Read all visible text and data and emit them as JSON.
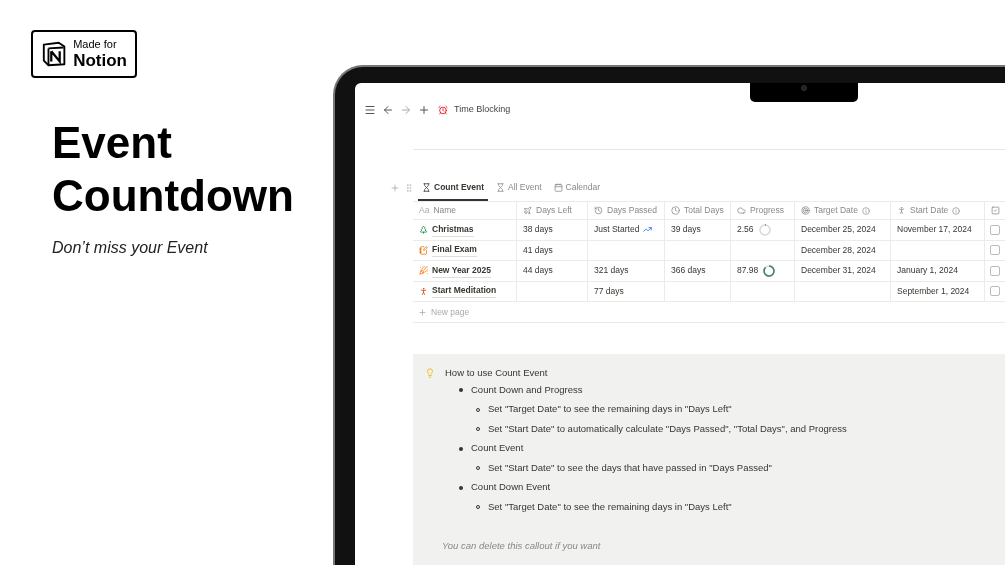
{
  "badge": {
    "line1": "Made for",
    "line2": "Notion"
  },
  "headline": [
    "Event",
    "Countdown"
  ],
  "tagline": "Don’t miss your Event",
  "app": {
    "breadcrumb": "Time Blocking",
    "views": [
      {
        "label": "Count Event",
        "selected": true
      },
      {
        "label": "All Event",
        "selected": false
      },
      {
        "label": "Calendar",
        "selected": false
      }
    ],
    "table": {
      "columns": [
        {
          "label": "Name",
          "prefix": "Aa"
        },
        {
          "label": "Days Left"
        },
        {
          "label": "Days Passed"
        },
        {
          "label": "Total Days"
        },
        {
          "label": "Progress"
        },
        {
          "label": "Target Date"
        },
        {
          "label": "Start Date"
        }
      ],
      "rows": [
        {
          "name": "Christmas",
          "days_left": "38 days",
          "days_passed": "Just Started",
          "trend_icon": true,
          "total_days": "39 days",
          "progress": {
            "value": "2.56"
          },
          "target_date": "December 25, 2024",
          "start_date": "November 17, 2024",
          "checked": false
        },
        {
          "name": "Final Exam",
          "days_left": "41 days",
          "trend_icon": false,
          "target_date": "December 28, 2024",
          "checked": false
        },
        {
          "name": "New Year 2025",
          "days_left": "44 days",
          "days_passed": "321 days",
          "trend_icon": false,
          "total_days": "366 days",
          "progress": {
            "value": "87.98"
          },
          "target_date": "December 31, 2024",
          "start_date": "January 1, 2024",
          "checked": false
        },
        {
          "name": "Start Meditation",
          "days_passed": "77 days",
          "trend_icon": false,
          "start_date": "September 1, 2024",
          "checked": false
        }
      ],
      "new_row": "New page"
    },
    "callout": {
      "title": "How to use Count Event",
      "items": [
        {
          "text": "Count Down and Progress",
          "children": [
            {
              "text": "Set \"Target Date\" to see the remaining days in \"Days Left\""
            },
            {
              "text": "Set \"Start Date\" to automatically calculate \"Days Passed\", \"Total Days\", and Progress"
            }
          ]
        },
        {
          "text": "Count Event",
          "children": [
            {
              "text": "Set \"Start Date\" to see the days that have passed in \"Days Passed\""
            }
          ]
        },
        {
          "text": "Count Down Event",
          "children": [
            {
              "text": "Set \"Target Date\" to see the remaining days in \"Days Left\""
            }
          ]
        }
      ],
      "note": "You can delete this callout if you want"
    }
  }
}
